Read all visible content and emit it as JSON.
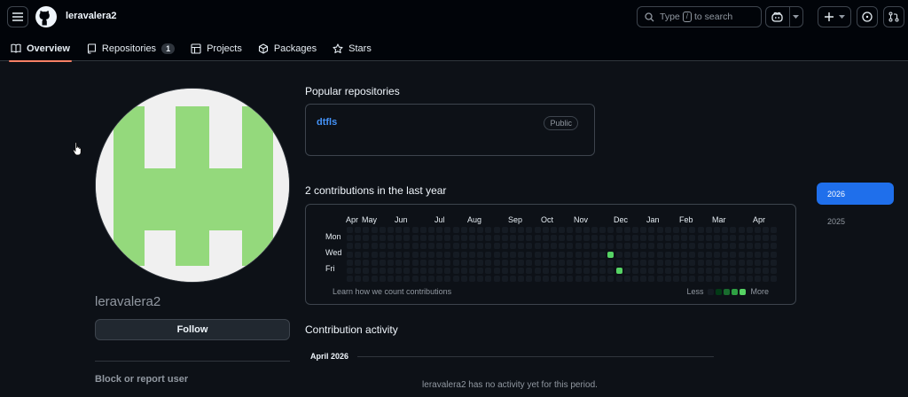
{
  "header": {
    "username": "leravalera2",
    "search_prefix": "Type",
    "search_key": "/",
    "search_suffix": "to search"
  },
  "tabs": [
    {
      "label": "Overview",
      "active": true
    },
    {
      "label": "Repositories",
      "count": "1"
    },
    {
      "label": "Projects"
    },
    {
      "label": "Packages"
    },
    {
      "label": "Stars"
    }
  ],
  "profile": {
    "name": "leravalera2",
    "follow_label": "Follow",
    "block_label": "Block or report user"
  },
  "popular": {
    "heading": "Popular repositories",
    "repos": [
      {
        "name": "dtfls",
        "visibility": "Public"
      }
    ]
  },
  "contributions": {
    "heading": "2 contributions in the last year",
    "months": [
      "Apr",
      "May",
      "Jun",
      "Jul",
      "Aug",
      "Sep",
      "Oct",
      "Nov",
      "Dec",
      "Jan",
      "Feb",
      "Mar",
      "Apr"
    ],
    "day_labels": [
      "Mon",
      "Wed",
      "Fri"
    ],
    "learn_text": "Learn how we count contributions",
    "legend_less": "Less",
    "legend_more": "More",
    "active_days": [
      {
        "week": 32,
        "day": 3
      },
      {
        "week": 33,
        "day": 5
      }
    ],
    "legend_colors": [
      "#151b23",
      "#033a16",
      "#196c2e",
      "#2ea043",
      "#56d364"
    ]
  },
  "years": {
    "active": "2026",
    "other": "2025"
  },
  "activity": {
    "heading": "Contribution activity",
    "month": "April 2026",
    "empty_text": "leravalera2 has no activity yet for this period."
  }
}
